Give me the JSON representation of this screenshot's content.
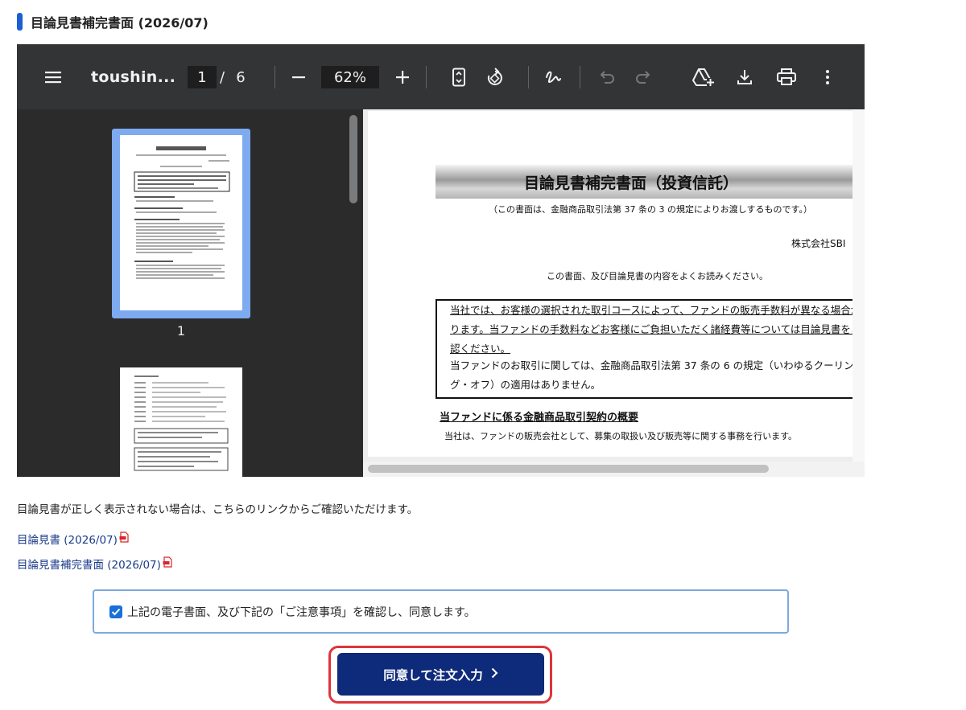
{
  "section": {
    "title": "目論見書補完書面 (2026/07)"
  },
  "viewer": {
    "doc_name": "toushin...",
    "current_page": "1",
    "page_sep": "/",
    "total_pages": "6",
    "zoom": "62%",
    "thumb_label": "1",
    "toolbar_icons": [
      "menu-icon",
      "zoom-out-icon",
      "zoom-in-icon",
      "fit-page-icon",
      "rotate-icon",
      "annotate-icon",
      "undo-icon",
      "redo-icon",
      "save-to-drive-icon",
      "download-icon",
      "print-icon",
      "more-icon"
    ],
    "document": {
      "title": "目論見書補完書面（投資信託）",
      "subtitle": "（この書面は、金融商品取引法第 37 条の 3 の規定によりお渡しするものです。）",
      "company": "株式会社SBI",
      "read_notice": "この書面、及び目論見書の内容をよくお読みください。",
      "box_lines": [
        "当社では、お客様の選択された取引コースによって、ファンドの販売手数料が異なる場合があ",
        "ります。当ファンドの手数料などお客様にご負担いただく諸経費等については目論見書をご確",
        "認ください。",
        "当ファンドのお取引に関しては、金融商品取引法第 37 条の 6 の規定（いわゆるクーリン",
        "グ・オフ）の適用はありません。"
      ],
      "heading": "当ファンドに係る金融商品取引契約の概要",
      "para": "当社は、ファンドの販売会社として、募集の取扱い及び販売等に関する事務を行います。"
    }
  },
  "notice": "目論見書が正しく表示されない場合は、こちらのリンクからご確認いただけます。",
  "links": [
    {
      "label": "目論見書 (2026/07)"
    },
    {
      "label": "目論見書補完書面 (2026/07)"
    }
  ],
  "agree": {
    "checked": true,
    "label": "上記の電子書面、及び下記の「ご注意事項」を確認し、同意します。"
  },
  "submit": {
    "label": "同意して注文入力"
  },
  "colors": {
    "accent_blue": "#1a5fd6",
    "button_navy": "#0e2a7a",
    "highlight_red": "#e0333a",
    "link": "#1a3a8a",
    "pdf_red": "#d9232a"
  }
}
